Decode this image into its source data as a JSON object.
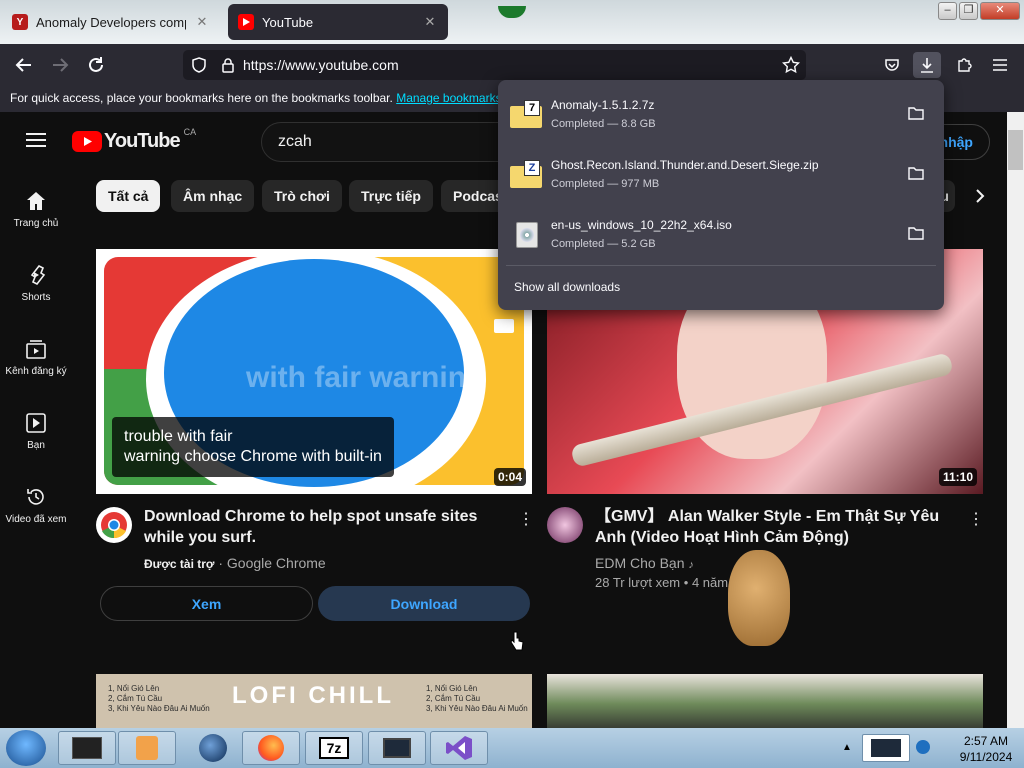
{
  "tabs": [
    {
      "title": "Anomaly Developers company",
      "favicon": "Y",
      "favicon_color": "#b71c1c"
    },
    {
      "title": "YouTube",
      "favicon": "youtube-icon",
      "favicon_color": "#ff0000"
    }
  ],
  "url": "https://www.youtube.com",
  "bookmarks": {
    "text": "For quick access, place your bookmarks here on the bookmarks toolbar.",
    "link": "Manage bookmarks..."
  },
  "youtube": {
    "logo_text": "YouTube",
    "region": "CA",
    "search_value": "zcah",
    "signin_partial": "nhập",
    "sidebar": [
      {
        "label": "Trang chủ",
        "icon": "home-icon"
      },
      {
        "label": "Shorts",
        "icon": "shorts-icon"
      },
      {
        "label": "Kênh đăng ký",
        "icon": "subscriptions-icon"
      },
      {
        "label": "Bạn",
        "icon": "you-icon"
      },
      {
        "label": "Video đã xem",
        "icon": "history-icon"
      }
    ],
    "chips": [
      "Tất cả",
      "Âm nhạc",
      "Trò chơi",
      "Trực tiếp",
      "Podcas",
      "u lu"
    ],
    "videos": [
      {
        "title": "Download Chrome to help spot unsafe sites while you surf.",
        "sponsor": "Được tài trợ",
        "channel": "Google Chrome",
        "duration": "0:04",
        "overlay_text": "with fair warning",
        "caption_line1": "trouble with fair",
        "caption_line2": "warning choose Chrome with built-in",
        "btn_watch": "Xem",
        "btn_download": "Download"
      },
      {
        "title": "【GMV】 Alan Walker Style - Em Thật Sự Yêu Anh (Video Hoạt Hình Cảm Động)",
        "channel": "EDM Cho Bạn",
        "views": "28 Tr lượt xem",
        "age": "4 năm",
        "duration": "11:10"
      },
      {
        "title": "LOFI CHILL",
        "tracklist": [
          "1, Nổi Gió Lên",
          "2, Cắm Tú Cầu",
          "3, Khi Yêu Nào Đâu Ai Muốn"
        ]
      }
    ]
  },
  "downloads": {
    "items": [
      {
        "name": "Anomaly-1.5.1.2.7z",
        "status": "Completed — 8.8 GB",
        "icon": "7z-folder-icon"
      },
      {
        "name": "Ghost.Recon.Island.Thunder.and.Desert.Siege.zip",
        "status": "Completed — 977 MB",
        "icon": "zip-folder-icon"
      },
      {
        "name": "en-us_windows_10_22h2_x64.iso",
        "status": "Completed — 5.2 GB",
        "icon": "disc-image-icon"
      }
    ],
    "show_all": "Show all downloads"
  },
  "taskbar": {
    "time": "2:57 AM",
    "date": "9/11/2024",
    "apps": [
      "start-orb-icon",
      "terminal-icon",
      "media-player-icon",
      "globe-icon",
      "firefox-icon",
      "7zip-icon",
      "monitor-icon",
      "visual-studio-icon"
    ]
  },
  "colors": {
    "yt_red": "#ff0000",
    "link_blue": "#3ea6ff",
    "firefox_toolbar": "#2b2a33",
    "download_panel": "#42414d"
  }
}
